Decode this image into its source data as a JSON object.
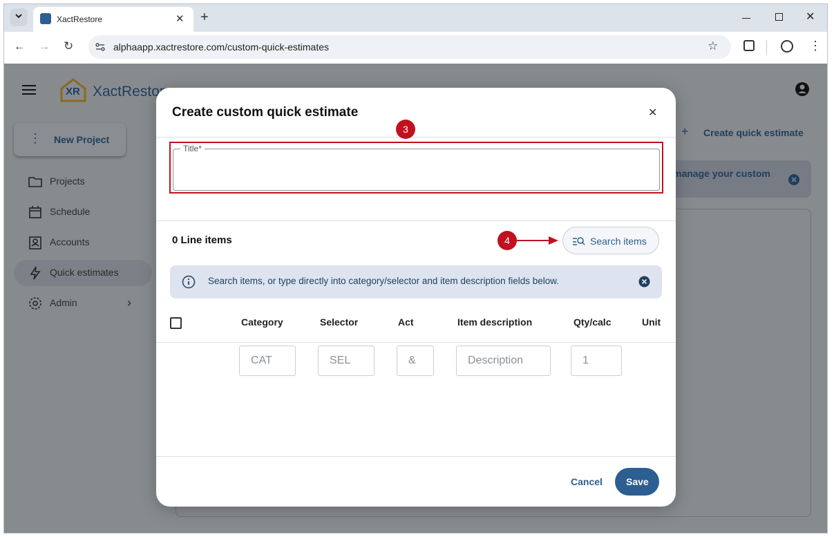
{
  "browser": {
    "tab_title": "XactRestore",
    "new_tab": "+",
    "url": "alphaapp.xactrestore.com/custom-quick-estimates"
  },
  "app": {
    "logo_mark": "XR",
    "logo_text": "XactRestore",
    "new_project": "New Project",
    "sidebar": [
      {
        "label": "Projects",
        "icon": "folder-icon"
      },
      {
        "label": "Schedule",
        "icon": "calendar-icon"
      },
      {
        "label": "Accounts",
        "icon": "contact-card-icon"
      },
      {
        "label": "Quick estimates",
        "icon": "lightning-icon"
      },
      {
        "label": "Admin",
        "icon": "gear-icon"
      }
    ],
    "create_quick_estimate": "Create quick estimate",
    "info_banner_text": "manage your custom"
  },
  "modal": {
    "title": "Create custom quick estimate",
    "title_field_label": "Title*",
    "title_field_value": "",
    "line_items_count": "0 Line items",
    "search_items": "Search items",
    "info_text": "Search items, or type directly into category/selector and item description fields below.",
    "columns": [
      "Category",
      "Selector",
      "Act",
      "Item description",
      "Qty/calc",
      "Unit"
    ],
    "row": {
      "category_placeholder": "CAT",
      "selector_placeholder": "SEL",
      "act_placeholder": "&",
      "description_placeholder": "Description",
      "qty_placeholder": "1"
    },
    "cancel": "Cancel",
    "save": "Save"
  },
  "annotations": {
    "step3": "3",
    "step4": "4"
  },
  "colors": {
    "accent": "#2c5e92",
    "annotation_red": "#c0111f",
    "info_bg": "#dde4f0",
    "overlay": "#888b8e"
  }
}
